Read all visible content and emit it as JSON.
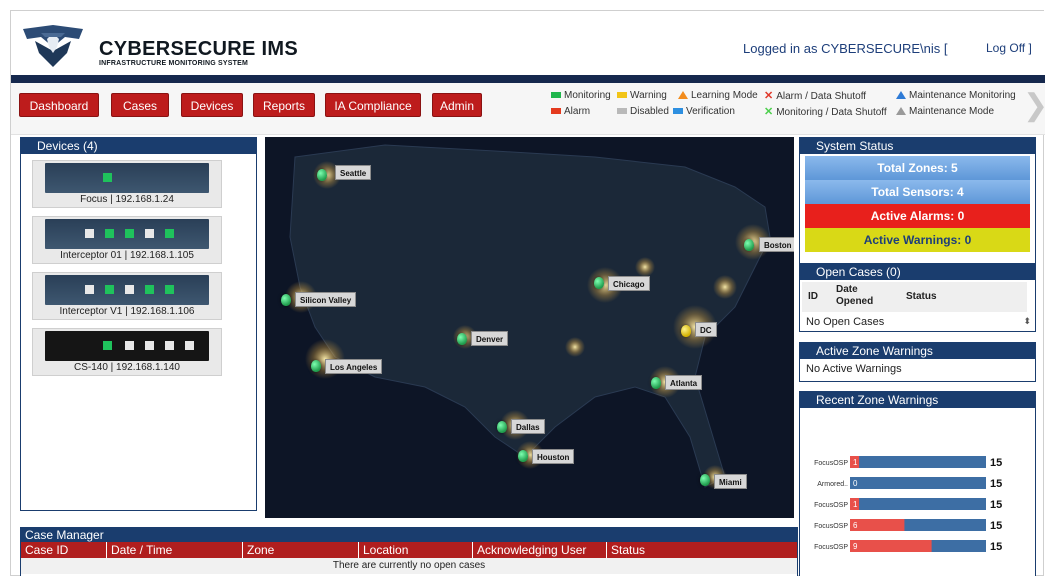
{
  "brand": {
    "name": "CYBERSECURE IMS",
    "subtitle": "INFRASTRUCTURE MONITORING SYSTEM",
    "logged_in_text": "Logged in as CYBERSECURE\\nis [",
    "logoff_label": "Log Off ]"
  },
  "nav": {
    "buttons": [
      "Dashboard",
      "Cases",
      "Devices",
      "Reports",
      "IA Compliance",
      "Admin"
    ]
  },
  "legend": {
    "monitoring": "Monitoring",
    "warning": "Warning",
    "learning_mode": "Learning Mode",
    "alarm_data_shutoff": "Alarm / Data Shutoff",
    "maintenance_monitoring": "Maintenance Monitoring",
    "alarm": "Alarm",
    "disabled": "Disabled",
    "verification": "Verification",
    "monitoring_data_shutoff": "Monitoring / Data Shutoff",
    "maintenance_mode": "Maintenance Mode",
    "colors": {
      "monitoring": "#1fb64c",
      "warning": "#f2c417",
      "learning_mode": "#f28c1d",
      "alarm_data_shutoff": "#e0392b",
      "maintenance_monitoring": "#2e7bd6",
      "alarm": "#e43a1e",
      "disabled": "#b9b9b9",
      "verification": "#2d8fe0",
      "monitoring_data_shutoff": "#4ccf4c",
      "maintenance_mode": "#9a9a9a"
    }
  },
  "devices": {
    "title": "Devices (4)",
    "items": [
      {
        "label": "Focus | 192.168.1.24"
      },
      {
        "label": "Interceptor 01 | 192.168.1.105"
      },
      {
        "label": "Interceptor V1 | 192.168.1.106"
      },
      {
        "label": "CS-140 | 192.168.1.140"
      }
    ]
  },
  "map": {
    "cities": [
      {
        "name": "Seattle",
        "marker": "green"
      },
      {
        "name": "Boston",
        "marker": "green"
      },
      {
        "name": "Chicago",
        "marker": "green"
      },
      {
        "name": "Silicon Valley",
        "marker": "green"
      },
      {
        "name": "Denver",
        "marker": "green"
      },
      {
        "name": "DC",
        "marker": "yellow"
      },
      {
        "name": "Los Angeles",
        "marker": "green"
      },
      {
        "name": "Atlanta",
        "marker": "green"
      },
      {
        "name": "Dallas",
        "marker": "green"
      },
      {
        "name": "Houston",
        "marker": "green"
      },
      {
        "name": "Miami",
        "marker": "green"
      }
    ]
  },
  "system_status": {
    "title": "System Status",
    "total_zones": "Total Zones: 5",
    "total_sensors": "Total Sensors: 4",
    "active_alarms": "Active Alarms: 0",
    "active_warnings": "Active Warnings: 0",
    "colors": {
      "zones": "#6fa6e3",
      "sensors": "#6fa6e3",
      "alarms": "#e8201c",
      "warnings": "#d9d916"
    }
  },
  "open_cases": {
    "title": "Open Cases (0)",
    "col_id": "ID",
    "col_date": "Date\nOpened",
    "col_status": "Status",
    "empty": "No Open Cases"
  },
  "active_zone_warnings": {
    "title": "Active Zone Warnings",
    "empty": "No Active Warnings"
  },
  "recent_zone_warnings": {
    "title": "Recent Zone Warnings"
  },
  "chart_data": {
    "type": "bar",
    "orientation": "horizontal",
    "stacked": true,
    "categories": [
      "FocusOSP",
      "Armored..",
      "FocusOSP",
      "FocusOSP",
      "FocusOSP"
    ],
    "warnings": [
      1,
      0,
      1,
      6,
      9
    ],
    "totals": [
      15,
      15,
      15,
      15,
      15
    ],
    "xlim": [
      0,
      15
    ],
    "colors": {
      "warnings": "#e8504a",
      "remainder": "#3d6ea4"
    }
  },
  "case_manager": {
    "title": "Case Manager",
    "columns": [
      "Case ID",
      "Date / Time",
      "Zone",
      "Location",
      "Acknowledging User",
      "Status"
    ],
    "empty": "There are currently no open cases"
  }
}
